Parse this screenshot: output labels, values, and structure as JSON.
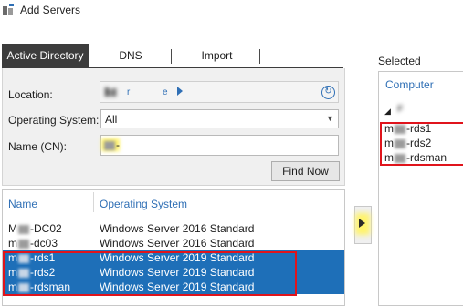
{
  "window": {
    "title": "Add Servers",
    "icon": "add-servers-icon"
  },
  "tabs": [
    {
      "label": "Active Directory",
      "active": true
    },
    {
      "label": "DNS",
      "active": false
    },
    {
      "label": "Import",
      "active": false
    }
  ],
  "query": {
    "location_label": "Location:",
    "location_value_start": "r",
    "location_value_end": "e",
    "os_label": "Operating System:",
    "os_value": "All",
    "name_label": "Name (CN):",
    "name_value": "-",
    "find_button": "Find Now"
  },
  "results": {
    "columns": [
      "Name",
      "Operating System"
    ],
    "rows": [
      {
        "name_prefix": "M",
        "name_suffix": "-DC02",
        "os": "Windows Server 2016 Standard",
        "selected": false
      },
      {
        "name_prefix": "m",
        "name_suffix": "-dc03",
        "os": "Windows Server 2016 Standard",
        "selected": false
      },
      {
        "name_prefix": "m",
        "name_suffix": "-rds1",
        "os": "Windows Server 2019 Standard",
        "selected": true
      },
      {
        "name_prefix": "m",
        "name_suffix": "-rds2",
        "os": "Windows Server 2019 Standard",
        "selected": true
      },
      {
        "name_prefix": "m",
        "name_suffix": "-rdsman",
        "os": "Windows Server 2019 Standard",
        "selected": true
      }
    ]
  },
  "selected_panel": {
    "label": "Selected",
    "column": "Computer",
    "group_label": "F",
    "items": [
      {
        "prefix": "m",
        "suffix": "-rds1"
      },
      {
        "prefix": "m",
        "suffix": "-rds2"
      },
      {
        "prefix": "m",
        "suffix": "-rdsman"
      }
    ]
  },
  "colors": {
    "accent": "#2f6fb5",
    "selection": "#1e6fb8",
    "highlight_box": "#e0141c",
    "marker": "#fff36a"
  }
}
